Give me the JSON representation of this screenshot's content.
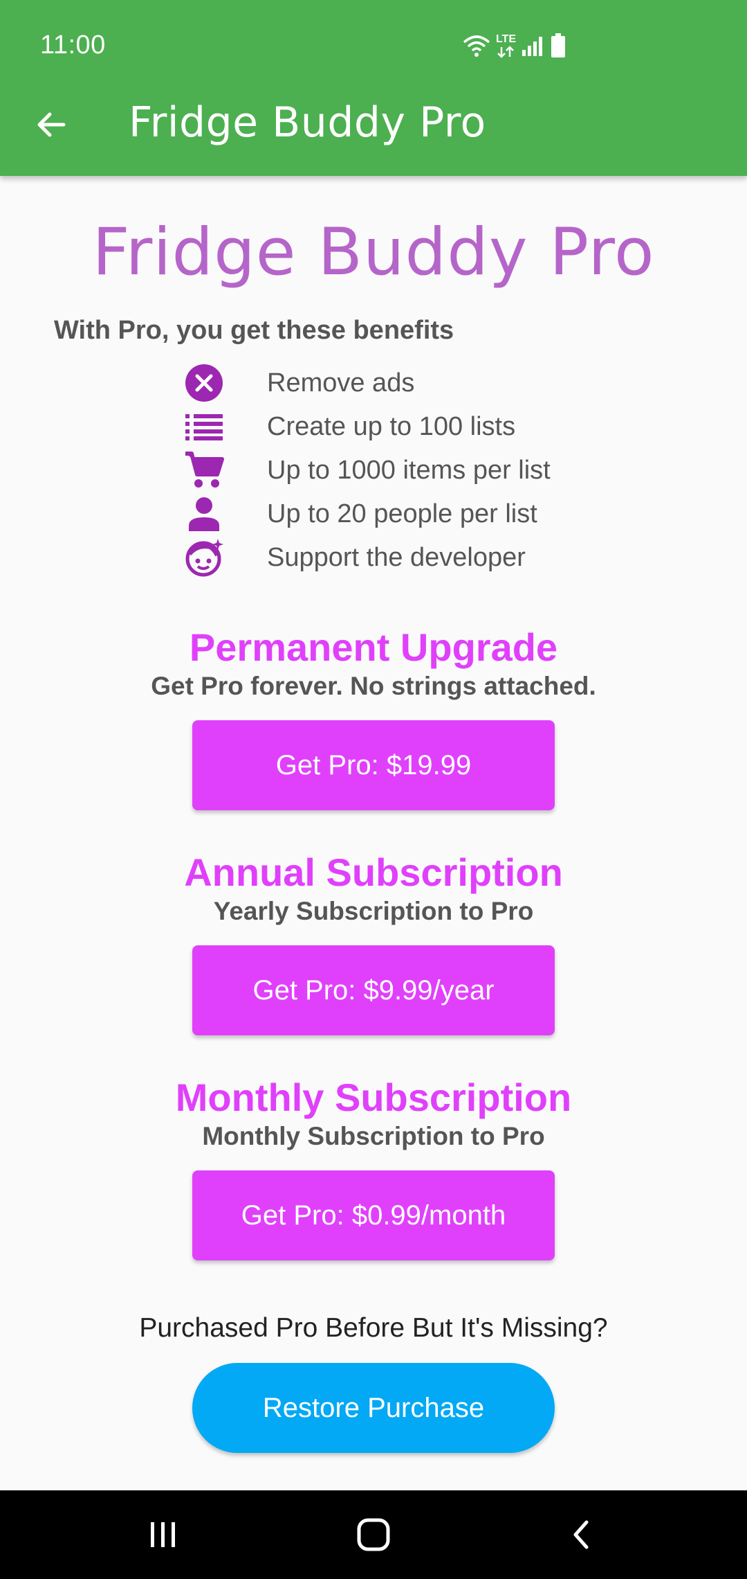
{
  "status_bar": {
    "time": "11:00",
    "icons": [
      "wifi-icon",
      "lte-icon",
      "signal-icon",
      "battery-icon"
    ],
    "network_label": "LTE"
  },
  "app_bar": {
    "title": "Fridge Buddy Pro",
    "back_icon": "arrow-back-icon"
  },
  "hero": {
    "title": "Fridge Buddy Pro"
  },
  "benefits": {
    "heading": "With Pro, you get these benefits",
    "items": [
      {
        "icon": "remove-ads-icon",
        "label": "Remove ads"
      },
      {
        "icon": "list-icon",
        "label": "Create up to 100 lists"
      },
      {
        "icon": "cart-icon",
        "label": "Up to 1000 items per list"
      },
      {
        "icon": "person-icon",
        "label": "Up to 20 people per list"
      },
      {
        "icon": "face-icon",
        "label": "Support the developer"
      }
    ]
  },
  "plans": [
    {
      "title": "Permanent Upgrade",
      "subtitle": "Get Pro forever. No strings attached.",
      "button": "Get Pro: $19.99"
    },
    {
      "title": "Annual Subscription",
      "subtitle": "Yearly Subscription to Pro",
      "button": "Get Pro: $9.99/year"
    },
    {
      "title": "Monthly Subscription",
      "subtitle": "Monthly Subscription to Pro",
      "button": "Get Pro: $0.99/month"
    }
  ],
  "restore": {
    "question": "Purchased Pro Before But It's Missing?",
    "button": "Restore Purchase"
  },
  "nav_bar": {
    "buttons": [
      "recents-icon",
      "home-icon",
      "back-icon"
    ]
  },
  "colors": {
    "app_bar": "#4caf50",
    "hero_title": "#b565c9",
    "accent": "#e040fb",
    "icon": "#9c27b0",
    "restore": "#03a9f4",
    "background": "#fafafa"
  }
}
